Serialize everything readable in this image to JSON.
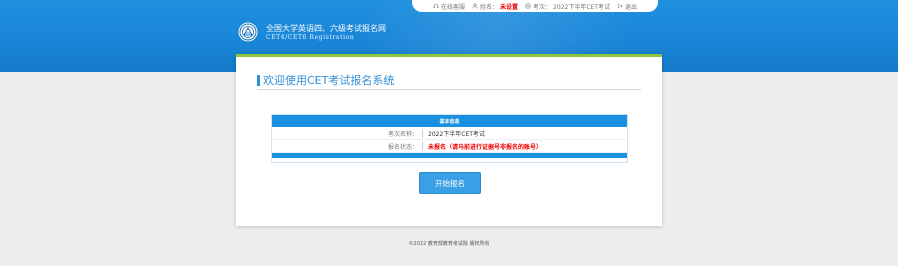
{
  "topbar": {
    "service_label": "在线客服",
    "name_label": "姓名：",
    "name_value": "未设置",
    "exam_label": "考次：",
    "exam_value": "2022下半年CET考试",
    "logout_label": "退出"
  },
  "brand": {
    "title": "全国大学英语四、六级考试报名网",
    "subtitle": "CET4/CET6  Registration"
  },
  "main": {
    "heading": "欢迎使用CET考试报名系统",
    "info_table": {
      "header": "基本信息",
      "rows": [
        {
          "label": "考次名称：",
          "value": "2022下半年CET考试"
        },
        {
          "label": "报名状态：",
          "value": "未报名（请马前进行证据号非报名的账号）"
        }
      ]
    },
    "start_button": "开始报名"
  },
  "footer": {
    "text": "©2022  教育部教育考试院  版权所有"
  },
  "colors": {
    "header_blue": "#1a86d8",
    "accent_green": "#8ec63f",
    "status_red": "#e00000",
    "button_blue": "#3aa0e6"
  },
  "icons": {
    "service": "headset-icon",
    "name": "user-icon",
    "exam": "globe-icon",
    "logout": "logout-icon",
    "logo": "cet-logo-icon"
  }
}
